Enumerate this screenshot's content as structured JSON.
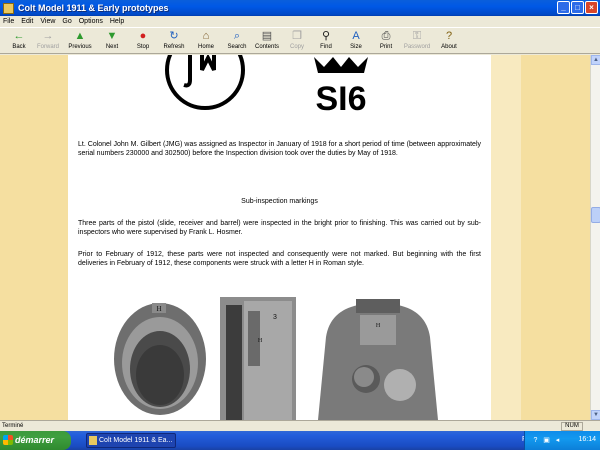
{
  "window": {
    "title": "Colt Model 1911 & Early prototypes"
  },
  "menu": [
    "File",
    "Edit",
    "View",
    "Go",
    "Options",
    "Help"
  ],
  "toolbar": [
    {
      "label": "Back",
      "icon": "←",
      "color": "#2E9A2E",
      "enabled": true
    },
    {
      "label": "Forward",
      "icon": "→",
      "color": "#A0A0A0",
      "enabled": false
    },
    {
      "label": "Previous",
      "icon": "▲",
      "color": "#2E9A2E",
      "enabled": true
    },
    {
      "label": "Next",
      "icon": "▼",
      "color": "#2E9A2E",
      "enabled": true
    },
    {
      "label": "Stop",
      "icon": "●",
      "color": "#D22020",
      "enabled": true
    },
    {
      "label": "Refresh",
      "icon": "↻",
      "color": "#2060C0",
      "enabled": true
    },
    {
      "label": "Home",
      "icon": "⌂",
      "color": "#806030",
      "enabled": true
    },
    {
      "label": "Search",
      "icon": "⌕",
      "color": "#2060C0",
      "enabled": true
    },
    {
      "label": "Contents",
      "icon": "▤",
      "color": "#505050",
      "enabled": true
    },
    {
      "label": "Copy",
      "icon": "❐",
      "color": "#A0A0A0",
      "enabled": false
    },
    {
      "label": "Find",
      "icon": "⚲",
      "color": "#202020",
      "enabled": true
    },
    {
      "label": "Size",
      "icon": "A",
      "color": "#2060C0",
      "enabled": true
    },
    {
      "label": "Print",
      "icon": "⎙",
      "color": "#404040",
      "enabled": true
    },
    {
      "label": "Password",
      "icon": "⚿",
      "color": "#A0A0A0",
      "enabled": false
    },
    {
      "label": "About",
      "icon": "?",
      "color": "#806010",
      "enabled": true
    }
  ],
  "content": {
    "logo_text": "SI6",
    "para1": "Lt. Colonel John M. Gilbert (JMG) was assigned as Inspector in January of 1918 for a short period of time (between approximately serial numbers 230000 and 302500) before the Inspection division took over the duties by May of 1918.",
    "heading": "Sub-inspection markings",
    "para2": "Three parts of the pistol (slide, receiver and barrel) were inspected in the bright prior to finishing. This was carried out by sub-inspectors who were supervised by Frank L. Hosmer.",
    "para3": "Prior to February of 1912, these parts were not inspected and consequently were not marked. But beginning with the first deliveries in February of 1912, these components were struck with a letter H in Roman style.",
    "photo1_mark": "H",
    "photo2_mark": "H",
    "photo2_num": "3",
    "photo3_mark": "H"
  },
  "status": {
    "text": "Terminé",
    "num": "NUM"
  },
  "taskbar": {
    "start": "démarrer",
    "task": "Colt Model 1911 & Ea...",
    "lang": "FR",
    "clock": "16:14"
  }
}
